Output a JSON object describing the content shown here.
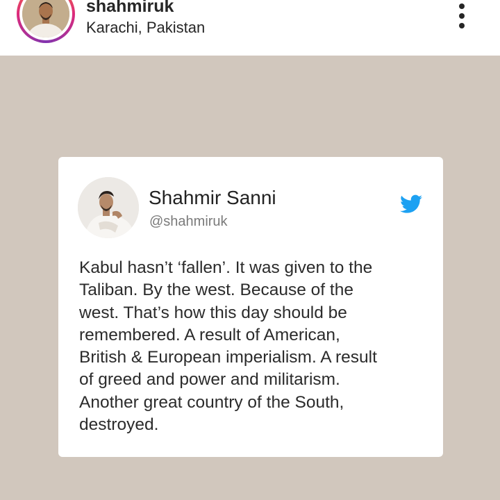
{
  "post_header": {
    "username": "shahmiruk",
    "location": "Karachi, Pakistan",
    "more_icon": "more-vertical-icon"
  },
  "tweet": {
    "display_name": "Shahmir Sanni",
    "handle": "@shahmiruk",
    "brand_icon": "twitter-bird-icon",
    "text_lines": [
      "Kabul hasn’t ‘fallen’. It was given to the",
      "Taliban. By the west. Because of the",
      "west. That’s how this day should be",
      "remembered. A result of American,",
      "British & European imperialism. A result",
      "of greed and power and militarism.",
      "Another great country of the South,",
      "destroyed."
    ]
  },
  "colors": {
    "background": "#d1c7bd",
    "twitter_blue": "#1da1f2",
    "text": "#262626"
  }
}
